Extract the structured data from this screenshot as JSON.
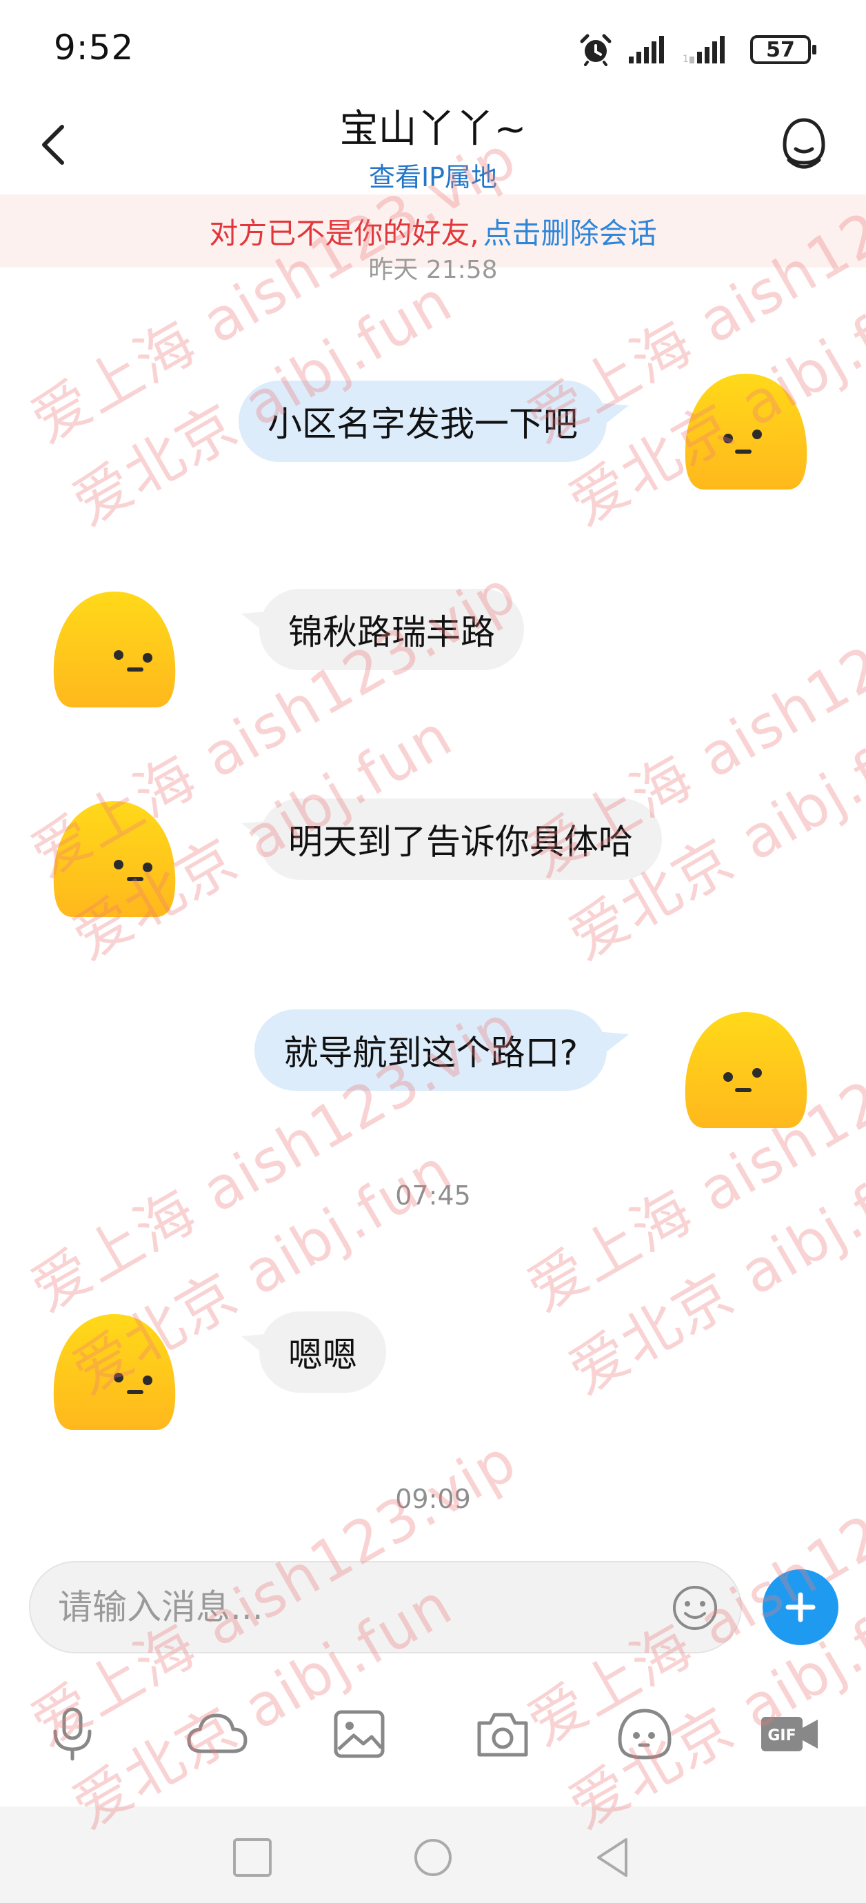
{
  "status_bar": {
    "time": "9:52",
    "battery": "57"
  },
  "header": {
    "title": "宝山丫丫~",
    "subtitle": "查看IP属地"
  },
  "banner": {
    "notice": "对方已不是你的好友,",
    "action": "点击删除会话"
  },
  "peek_timestamp": "昨天 21:58",
  "messages": [
    {
      "direction": "out",
      "text": "小区名字发我一下吧"
    },
    {
      "direction": "in",
      "text": "锦秋路瑞丰路"
    },
    {
      "direction": "in",
      "text": "明天到了告诉你具体哈"
    },
    {
      "direction": "out",
      "text": "就导航到这个路口?"
    },
    {
      "timestamp": "07:45"
    },
    {
      "direction": "in",
      "text": "嗯嗯"
    },
    {
      "timestamp": "09:09"
    }
  ],
  "input": {
    "placeholder": "请输入消息..."
  },
  "toolbar": [
    "mic-icon",
    "cloud-icon",
    "image-icon",
    "camera-icon",
    "sticker-icon",
    "gif-icon"
  ],
  "watermark": {
    "line1": "爱上海 aish123.vip",
    "line2": "爱北京 aibj.fun"
  },
  "colors": {
    "accent": "#1e9bf0",
    "outgoing_bubble": "#dcecfb",
    "incoming_bubble": "#f1f1f1",
    "avatar_yellow": "#ffd21a",
    "warning_red": "#e2373a",
    "link_blue": "#2f86d8"
  }
}
